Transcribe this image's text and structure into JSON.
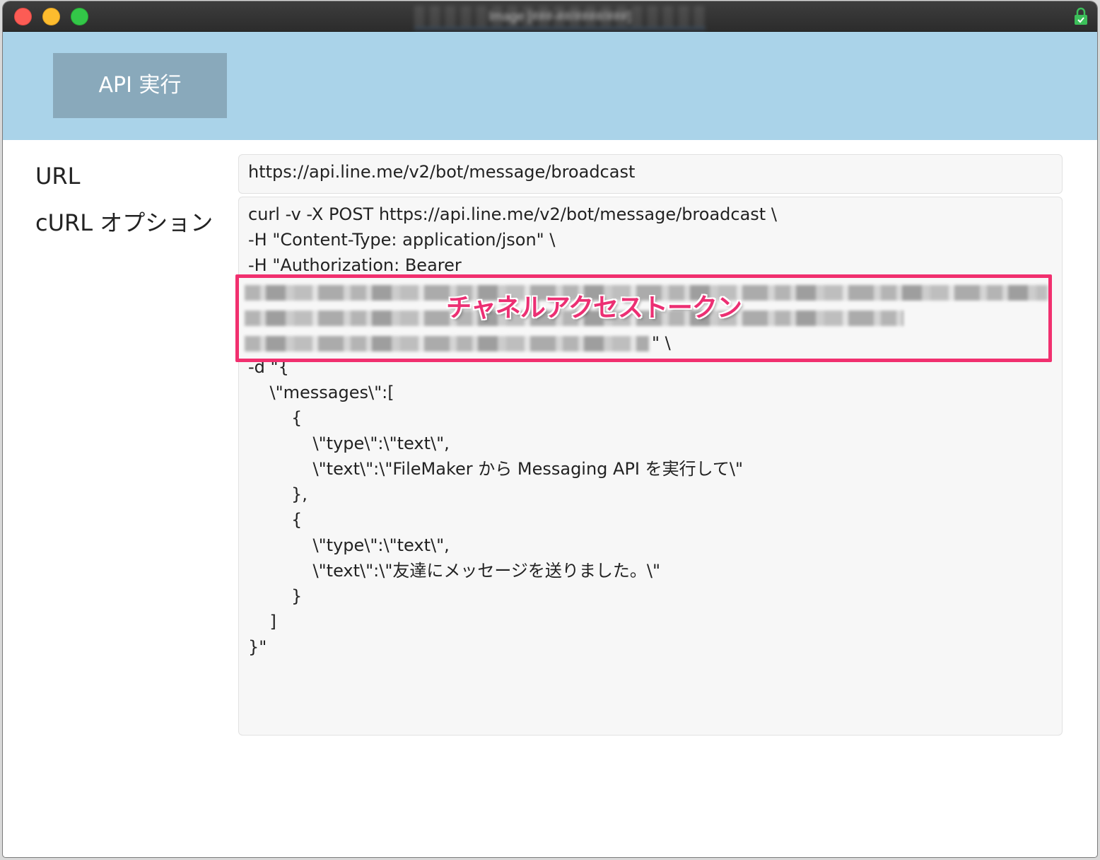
{
  "window": {
    "title": "Image [###-##/####/###]"
  },
  "toolbar": {
    "api_button_label": "API 実行"
  },
  "form": {
    "url_label": "URL",
    "url_value": "https://api.line.me/v2/bot/message/broadcast",
    "curl_label": "cURL オプション",
    "curl_lines": [
      "curl -v -X POST https://api.line.me/v2/bot/message/broadcast \\",
      "-H \"Content-Type: application/json\" \\",
      "-H \"Authorization: Bearer",
      "\" \\",
      "-d \"{",
      "    \\\"messages\\\":[",
      "        {",
      "            \\\"type\\\":\\\"text\\\",",
      "            \\\"text\\\":\\\"FileMaker から Messaging API を実行して\\\"",
      "        },",
      "        {",
      "            \\\"type\\\":\\\"text\\\",",
      "            \\\"text\\\":\\\"友達にメッセージを送りました。\\\"",
      "        }",
      "    ]",
      "}\""
    ]
  },
  "annotation": {
    "token_label": "チャネルアクセストークン",
    "highlight_color": "#f1306f"
  },
  "colors": {
    "header_band": "#aad3e9",
    "api_button": "#89a9bb"
  },
  "icons": {
    "lock": "lock-icon"
  }
}
